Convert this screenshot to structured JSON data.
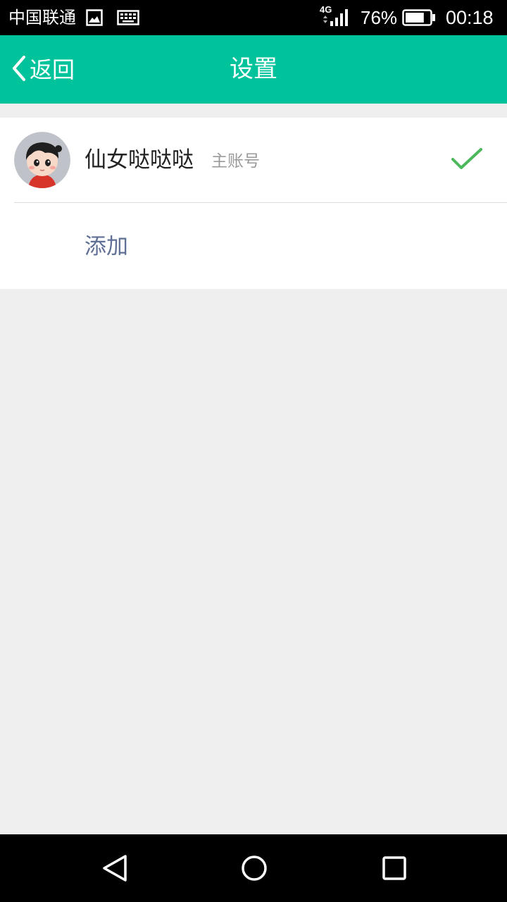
{
  "status_bar": {
    "carrier": "中国联通",
    "network": "4G",
    "battery_percent": "76%",
    "battery_level": 0.76,
    "time": "00:18",
    "icons": [
      "image-icon",
      "keyboard-icon",
      "signal-icon",
      "battery-icon"
    ]
  },
  "header": {
    "back_label": "返回",
    "title": "设置",
    "background_color": "#00c39c"
  },
  "accounts": {
    "current": {
      "name": "仙女哒哒哒",
      "badge": "主账号",
      "selected": true,
      "check_color": "#4cb85c"
    },
    "add_label": "添加",
    "add_label_color": "#5f6f95"
  },
  "nav_bar": {
    "icons": [
      "back-triangle-icon",
      "home-circle-icon",
      "recents-square-icon"
    ]
  }
}
